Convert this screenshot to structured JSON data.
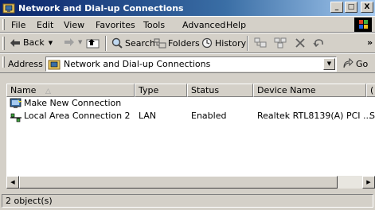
{
  "window": {
    "title": "Network and Dial-up Connections",
    "min_label": "_",
    "max_label": "□",
    "close_label": "X"
  },
  "menu": [
    {
      "label": "File"
    },
    {
      "label": "Edit"
    },
    {
      "label": "View"
    },
    {
      "label": "Favorites"
    },
    {
      "label": "Tools"
    },
    {
      "label": "Advanced"
    },
    {
      "label": "Help"
    }
  ],
  "toolbar": {
    "back_label": "Back",
    "search_label": "Search",
    "folders_label": "Folders",
    "history_label": "History",
    "overflow_label": "»"
  },
  "address": {
    "label": "Address",
    "value": "Network and Dial-up Connections",
    "go_label": "Go"
  },
  "list": {
    "columns": [
      {
        "label": "Name"
      },
      {
        "label": "Type"
      },
      {
        "label": "Status"
      },
      {
        "label": "Device Name"
      },
      {
        "label": "("
      }
    ],
    "rows": [
      {
        "name": "Make New Connection",
        "type": "",
        "status": "",
        "device": "",
        "extra": "",
        "icon": "new-connection-icon"
      },
      {
        "name": "Local Area Connection 2",
        "type": "LAN",
        "status": "Enabled",
        "device": "Realtek RTL8139(A) PCI ...",
        "extra": "S",
        "icon": "lan-connection-icon"
      }
    ]
  },
  "status": {
    "text": "2 object(s)"
  },
  "colors": {
    "title_start": "#0a246a",
    "title_end": "#a6caf0",
    "chrome": "#d4d0c8"
  }
}
